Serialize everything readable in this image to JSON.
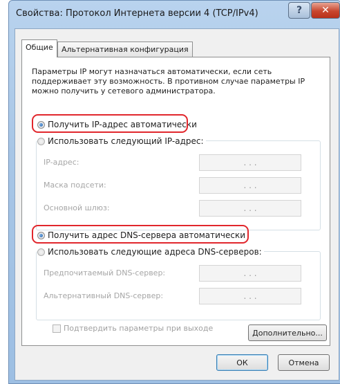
{
  "window": {
    "title": "Свойства: Протокол Интернета версии 4 (TCP/IPv4)",
    "help_glyph": "?",
    "close_glyph": "✕"
  },
  "tabs": [
    {
      "label": "Общие",
      "active": true
    },
    {
      "label": "Альтернативная конфигурация",
      "active": false
    }
  ],
  "description": "Параметры IP могут назначаться автоматически, если сеть поддерживает эту возможность. В противном случае параметры IP можно получить у сетевого администратора.",
  "ip_section": {
    "auto_label": "Получить IP-адрес автоматически",
    "manual_label": "Использовать следующий IP-адрес:",
    "selected": "auto",
    "fields": [
      {
        "label": "IP-адрес:",
        "value": ".   .   ."
      },
      {
        "label": "Маска подсети:",
        "value": ".   .   ."
      },
      {
        "label": "Основной шлюз:",
        "value": ".   .   ."
      }
    ]
  },
  "dns_section": {
    "auto_label": "Получить адрес DNS-сервера автоматически",
    "manual_label": "Использовать следующие адреса DNS-серверов:",
    "selected": "auto",
    "fields": [
      {
        "label": "Предпочитаемый DNS-сервер:",
        "value": ".   .   ."
      },
      {
        "label": "Альтернативный DNS-сервер:",
        "value": ".   .   ."
      }
    ]
  },
  "validate_label": "Подтвердить параметры при выходе",
  "advanced_label": "Дополнительно...",
  "ok_label": "ОК",
  "cancel_label": "Отмена",
  "colors": {
    "highlight": "#e1262c",
    "title_bar": "#a8c6e6"
  }
}
